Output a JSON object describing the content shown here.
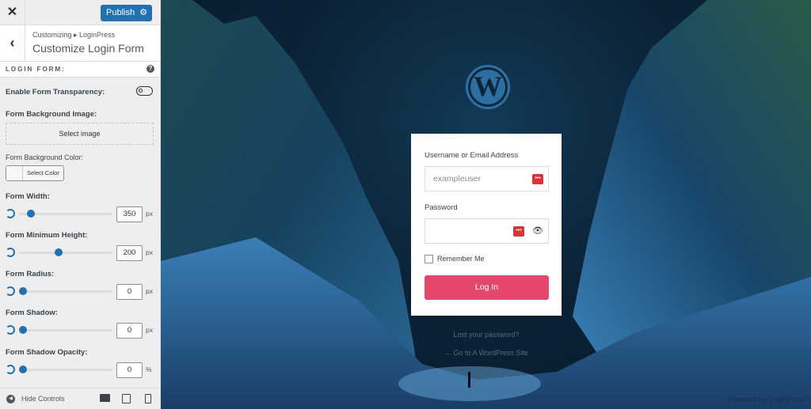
{
  "topbar": {
    "close_icon": "close-icon",
    "publish_label": "Publish",
    "settings_icon": "gear-icon"
  },
  "header": {
    "breadcrumb": "Customizing ▸ LoginPress",
    "title": "Customize Login Form"
  },
  "section": {
    "title": "LOGIN FORM:",
    "help": "?"
  },
  "controls": {
    "transparency_label": "Enable Form Transparency:",
    "transparency_on": false,
    "bg_image_label": "Form Background Image:",
    "select_image": "Select image",
    "bg_color_label": "Form Background Color:",
    "select_color": "Select Color",
    "sliders": [
      {
        "label": "Form Width:",
        "value": "350",
        "unit": "px",
        "level": 0.09
      },
      {
        "label": "Form Minimum Height:",
        "value": "200",
        "unit": "px",
        "level": 0.4
      },
      {
        "label": "Form Radius:",
        "value": "0",
        "unit": "px",
        "level": 0
      },
      {
        "label": "Form Shadow:",
        "value": "0",
        "unit": "px",
        "level": 0
      },
      {
        "label": "Form Shadow Opacity:",
        "value": "0",
        "unit": "%",
        "level": 0
      }
    ]
  },
  "footer": {
    "hide_controls": "Hide Controls"
  },
  "preview": {
    "logo": "W",
    "username_label": "Username or Email Address",
    "username_value": "exampleuser",
    "password_label": "Password",
    "remember_label": "Remember Me",
    "login_button": "Log In",
    "lost_password": "Lost your password?",
    "go_to_site": "← Go to A WordPress Site",
    "powered_by": "Powered by: LoginPress"
  },
  "colors": {
    "accent": "#2271b1",
    "login_button": "#e5476c",
    "password_manager": "#d63638"
  }
}
